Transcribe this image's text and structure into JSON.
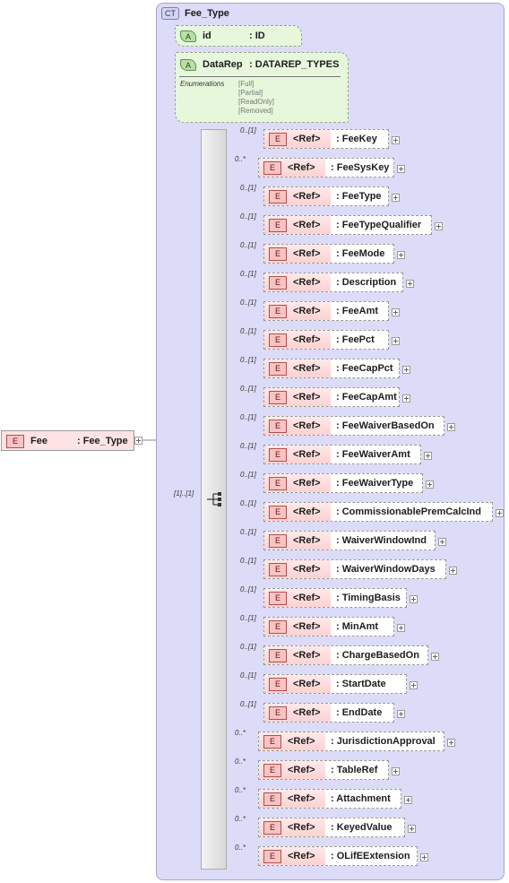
{
  "root": {
    "badge": "E",
    "name": "Fee",
    "type": ": Fee_Type"
  },
  "complex_type": {
    "badge": "CT",
    "name": "Fee_Type"
  },
  "attributes": [
    {
      "badge": "A",
      "name": "id",
      "type": ": ID"
    },
    {
      "badge": "A",
      "name": "DataRep",
      "type": ": DATAREP_TYPES"
    }
  ],
  "enumerations": {
    "label": "Enumerations",
    "values": [
      "[Full]",
      "[Partial]",
      "[ReadOnly]",
      "[Removed]"
    ]
  },
  "sequence": {
    "multiplicity": "[1]..[1]"
  },
  "elements": [
    {
      "mult": "0..[1]",
      "badge": "E",
      "ref": "<Ref>",
      "name": ": FeeKey"
    },
    {
      "mult": "0..*",
      "badge": "E",
      "ref": "<Ref>",
      "name": ": FeeSysKey"
    },
    {
      "mult": "0..[1]",
      "badge": "E",
      "ref": "<Ref>",
      "name": ": FeeType"
    },
    {
      "mult": "0..[1]",
      "badge": "E",
      "ref": "<Ref>",
      "name": ": FeeTypeQualifier"
    },
    {
      "mult": "0..[1]",
      "badge": "E",
      "ref": "<Ref>",
      "name": ": FeeMode"
    },
    {
      "mult": "0..[1]",
      "badge": "E",
      "ref": "<Ref>",
      "name": ": Description"
    },
    {
      "mult": "0..[1]",
      "badge": "E",
      "ref": "<Ref>",
      "name": ": FeeAmt"
    },
    {
      "mult": "0..[1]",
      "badge": "E",
      "ref": "<Ref>",
      "name": ": FeePct"
    },
    {
      "mult": "0..[1]",
      "badge": "E",
      "ref": "<Ref>",
      "name": ": FeeCapPct"
    },
    {
      "mult": "0..[1]",
      "badge": "E",
      "ref": "<Ref>",
      "name": ": FeeCapAmt"
    },
    {
      "mult": "0..[1]",
      "badge": "E",
      "ref": "<Ref>",
      "name": ": FeeWaiverBasedOn"
    },
    {
      "mult": "0..[1]",
      "badge": "E",
      "ref": "<Ref>",
      "name": ": FeeWaiverAmt"
    },
    {
      "mult": "0..[1]",
      "badge": "E",
      "ref": "<Ref>",
      "name": ": FeeWaiverType"
    },
    {
      "mult": "0..[1]",
      "badge": "E",
      "ref": "<Ref>",
      "name": ": CommissionablePremCalcInd"
    },
    {
      "mult": "0..[1]",
      "badge": "E",
      "ref": "<Ref>",
      "name": ": WaiverWindowInd"
    },
    {
      "mult": "0..[1]",
      "badge": "E",
      "ref": "<Ref>",
      "name": ": WaiverWindowDays"
    },
    {
      "mult": "0..[1]",
      "badge": "E",
      "ref": "<Ref>",
      "name": ": TimingBasis"
    },
    {
      "mult": "0..[1]",
      "badge": "E",
      "ref": "<Ref>",
      "name": ": MinAmt"
    },
    {
      "mult": "0..[1]",
      "badge": "E",
      "ref": "<Ref>",
      "name": ": ChargeBasedOn"
    },
    {
      "mult": "0..[1]",
      "badge": "E",
      "ref": "<Ref>",
      "name": ": StartDate"
    },
    {
      "mult": "0..[1]",
      "badge": "E",
      "ref": "<Ref>",
      "name": ": EndDate"
    },
    {
      "mult": "0..*",
      "badge": "E",
      "ref": "<Ref>",
      "name": ": JurisdictionApproval"
    },
    {
      "mult": "0..*",
      "badge": "E",
      "ref": "<Ref>",
      "name": ": TableRef"
    },
    {
      "mult": "0..*",
      "badge": "E",
      "ref": "<Ref>",
      "name": ": Attachment"
    },
    {
      "mult": "0..*",
      "badge": "E",
      "ref": "<Ref>",
      "name": ": KeyedValue"
    },
    {
      "mult": "0..*",
      "badge": "E",
      "ref": "<Ref>",
      "name": ": OLifEExtension"
    }
  ]
}
